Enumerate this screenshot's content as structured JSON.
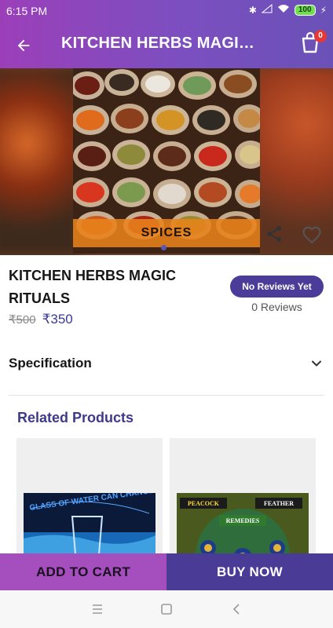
{
  "status_bar": {
    "time": "6:15 PM",
    "battery": "100"
  },
  "app_bar": {
    "title": "KITCHEN HERBS MAGIC ...",
    "cart_count": "0"
  },
  "gallery": {
    "image_caption": "SPICES",
    "page_count": 1,
    "active_page": 1
  },
  "product": {
    "name_line1": "KITCHEN HERBS MAGIC",
    "name_line2": "RITUALS",
    "price_old": "₹500",
    "price_new": "₹350",
    "reviews_badge": "No Reviews Yet",
    "reviews_count": "0 Reviews"
  },
  "specification": {
    "label": "Specification"
  },
  "related": {
    "title": "Related Products",
    "items": [
      {
        "image_text": "GLASS OF WATER CAN CHANGE YOUR LIFE"
      },
      {
        "image_text_1": "PEACOCK",
        "image_text_2": "FEATHER",
        "image_text_3": "REMEDIES"
      }
    ]
  },
  "actions": {
    "add_to_cart": "ADD TO CART",
    "buy_now": "BUY NOW"
  },
  "colors": {
    "accent_purple": "#9b3fb9",
    "deep_indigo": "#4a3b97",
    "price_blue": "#3b3a9a"
  },
  "icons": [
    "back-arrow-icon",
    "cart-icon",
    "share-icon",
    "heart-icon",
    "chevron-down-icon",
    "menu-icon",
    "home-square-icon",
    "back-triangle-icon"
  ]
}
